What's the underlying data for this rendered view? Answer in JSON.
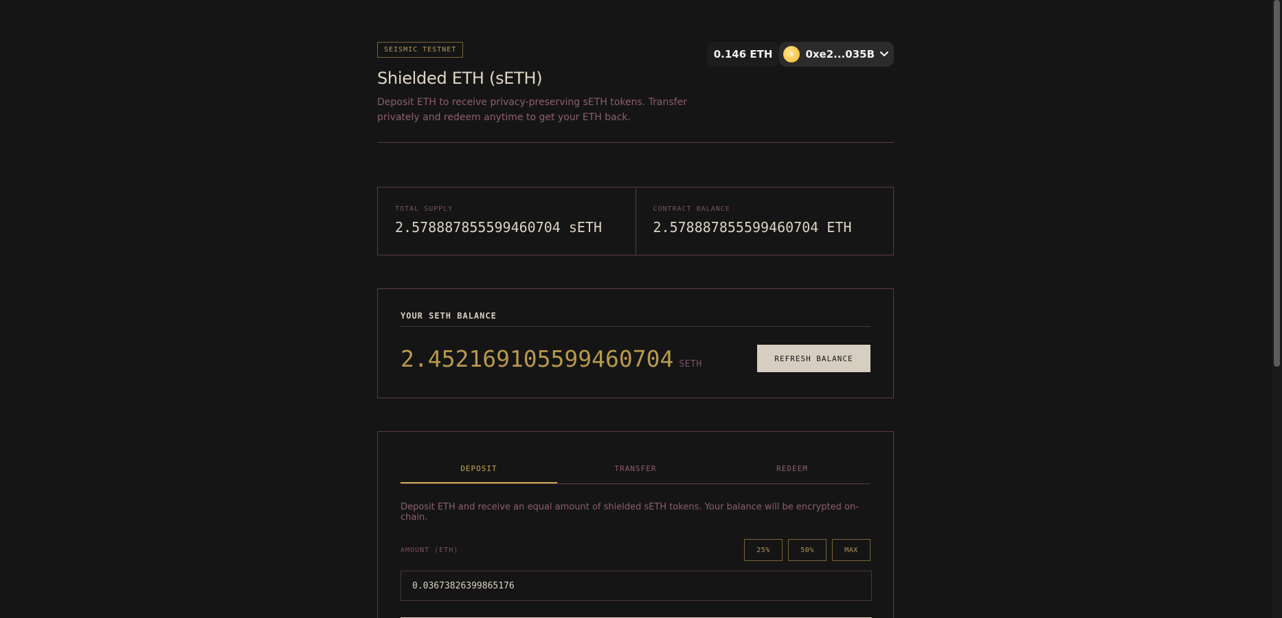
{
  "header": {
    "network_tag": "SEISMIC TESTNET",
    "title": "Shielded ETH (sETH)",
    "subtitle": "Deposit ETH to receive privacy-preserving sETH tokens. Transfer privately and redeem anytime to get your ETH back."
  },
  "wallet": {
    "eth_balance": "0.146 ETH",
    "address": "0xe2...035B",
    "avatar_icon": "coin-avatar-icon",
    "chevron_icon": "chevron-down-icon"
  },
  "stats": {
    "total_supply_label": "TOTAL SUPPLY",
    "total_supply_value": "2.578887855599460704 sETH",
    "contract_balance_label": "CONTRACT BALANCE",
    "contract_balance_value": "2.578887855599460704 ETH"
  },
  "balance": {
    "label": "YOUR SETH BALANCE",
    "value": "2.452169105599460704",
    "unit": "SETH",
    "refresh_label": "REFRESH BALANCE"
  },
  "actions": {
    "tabs": [
      {
        "label": "DEPOSIT",
        "active": true
      },
      {
        "label": "TRANSFER",
        "active": false
      },
      {
        "label": "REDEEM",
        "active": false
      }
    ],
    "description": "Deposit ETH and receive an equal amount of shielded sETH tokens. Your balance will be encrypted on-chain.",
    "amount_label": "AMOUNT (ETH)",
    "pct_buttons": [
      "25%",
      "50%",
      "MAX"
    ],
    "amount_value": "0.03673826399865176"
  },
  "colors": {
    "background": "#151515",
    "accent_gold": "#c9a94e",
    "muted_mauve": "#8e5e72",
    "border": "#5a3c46",
    "button_light": "#d6cec0"
  }
}
